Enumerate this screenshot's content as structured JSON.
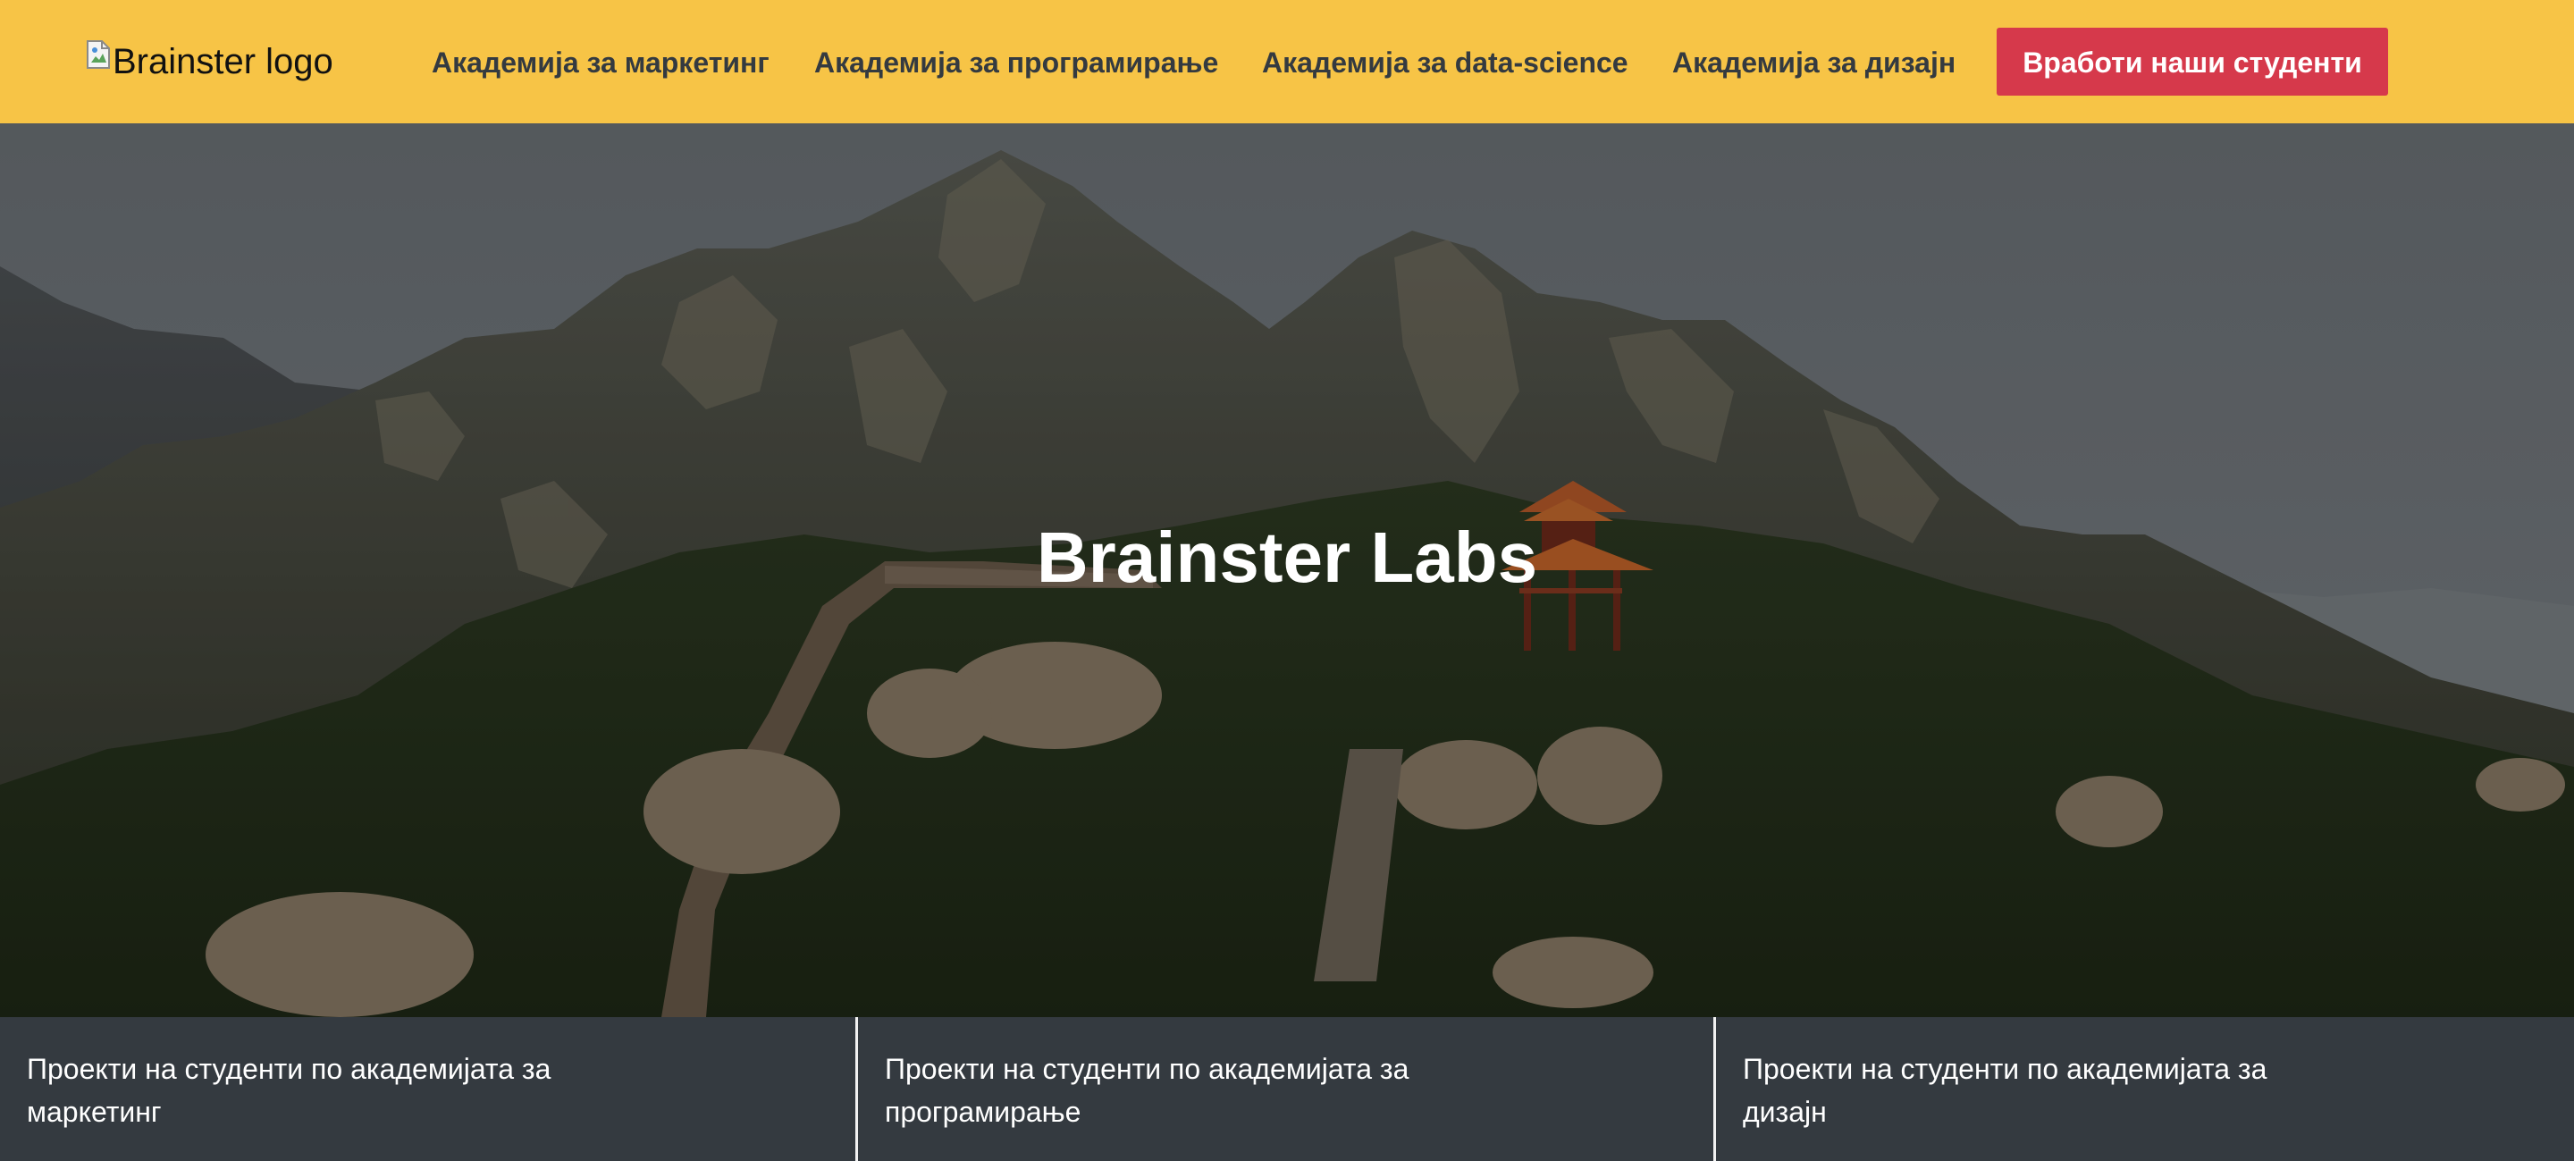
{
  "navbar": {
    "logo_alt": "Brainster logo",
    "links": [
      {
        "label": "Академија за маркетинг"
      },
      {
        "label": "Академија за програмирање"
      },
      {
        "label": "Академија за data-science"
      },
      {
        "label": "Академија за дизајн"
      }
    ],
    "cta_label": "Вработи наши студенти",
    "colors": {
      "background": "#f7c446",
      "link": "#343a40",
      "cta_background": "#d6394b",
      "cta_text": "#ffffff"
    }
  },
  "hero": {
    "title": "Brainster Labs",
    "image_icon": "mountain-landscape-with-pagoda"
  },
  "cards": [
    {
      "label": "Проекти на студенти по академијата за маркетинг"
    },
    {
      "label": "Проекти на студенти по академијата за програмирање"
    },
    {
      "label": "Проекти на студенти по академијата за дизајн"
    }
  ],
  "colors": {
    "cards_background": "#343a40",
    "cards_text": "#ffffff"
  }
}
